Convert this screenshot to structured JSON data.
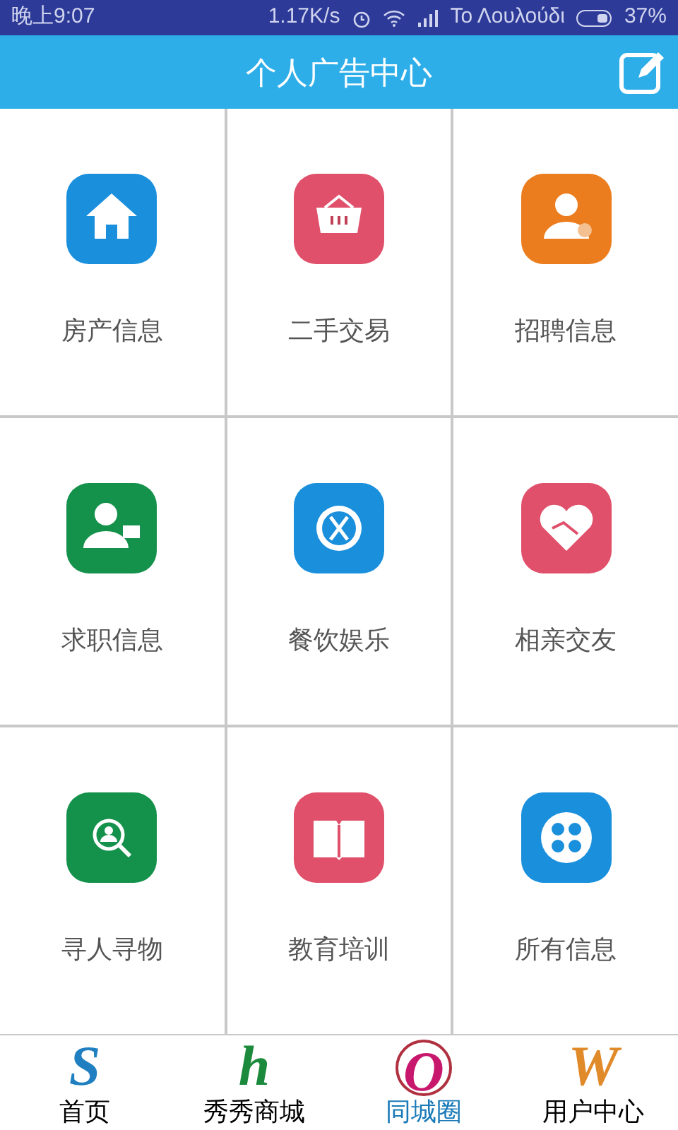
{
  "status_bar": {
    "time": "晚上9:07",
    "speed": "1.17K/s",
    "carrier": "Το Λουλούδι",
    "battery": "37%"
  },
  "header": {
    "title": "个人广告中心"
  },
  "tiles": [
    {
      "label": "房产信息",
      "kind": "house",
      "color": "#1a8fdc"
    },
    {
      "label": "二手交易",
      "kind": "basket",
      "color": "#e0506a"
    },
    {
      "label": "招聘信息",
      "kind": "recruit",
      "color": "#ec7d1e"
    },
    {
      "label": "求职信息",
      "kind": "jobseek",
      "color": "#14914a"
    },
    {
      "label": "餐饮娱乐",
      "kind": "dining",
      "color": "#1a8fdc"
    },
    {
      "label": "相亲交友",
      "kind": "heart",
      "color": "#e0506a"
    },
    {
      "label": "寻人寻物",
      "kind": "search",
      "color": "#14914a"
    },
    {
      "label": "教育培训",
      "kind": "book",
      "color": "#e0506a"
    },
    {
      "label": "所有信息",
      "kind": "all",
      "color": "#1a8fdc"
    }
  ],
  "bottom_nav": [
    {
      "label": "首页",
      "logo": "S",
      "selected": false,
      "color": "#1f7fc0"
    },
    {
      "label": "秀秀商城",
      "logo": "h",
      "selected": false,
      "color": "#1c8a3c"
    },
    {
      "label": "同城圈",
      "logo": "O",
      "selected": true,
      "color": "#c8186e"
    },
    {
      "label": "用户中心",
      "logo": "W",
      "selected": false,
      "color": "#e08a2a"
    }
  ]
}
